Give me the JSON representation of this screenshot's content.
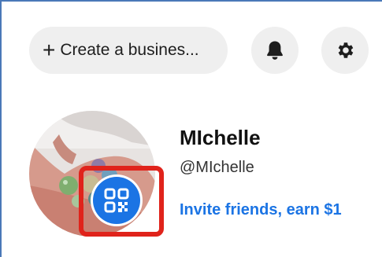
{
  "header": {
    "create_label": "Create a busines...",
    "plus_glyph": "+",
    "icons": {
      "notifications": "bell-icon",
      "settings": "gear-icon"
    }
  },
  "profile": {
    "name": "MIchelle",
    "handle": "@MIchelle",
    "invite_label": "Invite friends, earn $1",
    "qr_icon": "qr-code-icon"
  },
  "colors": {
    "accent_blue": "#1b74e4",
    "button_bg": "#efefef",
    "highlight_red": "#e0231b",
    "frame_blue": "#4a78b8"
  }
}
